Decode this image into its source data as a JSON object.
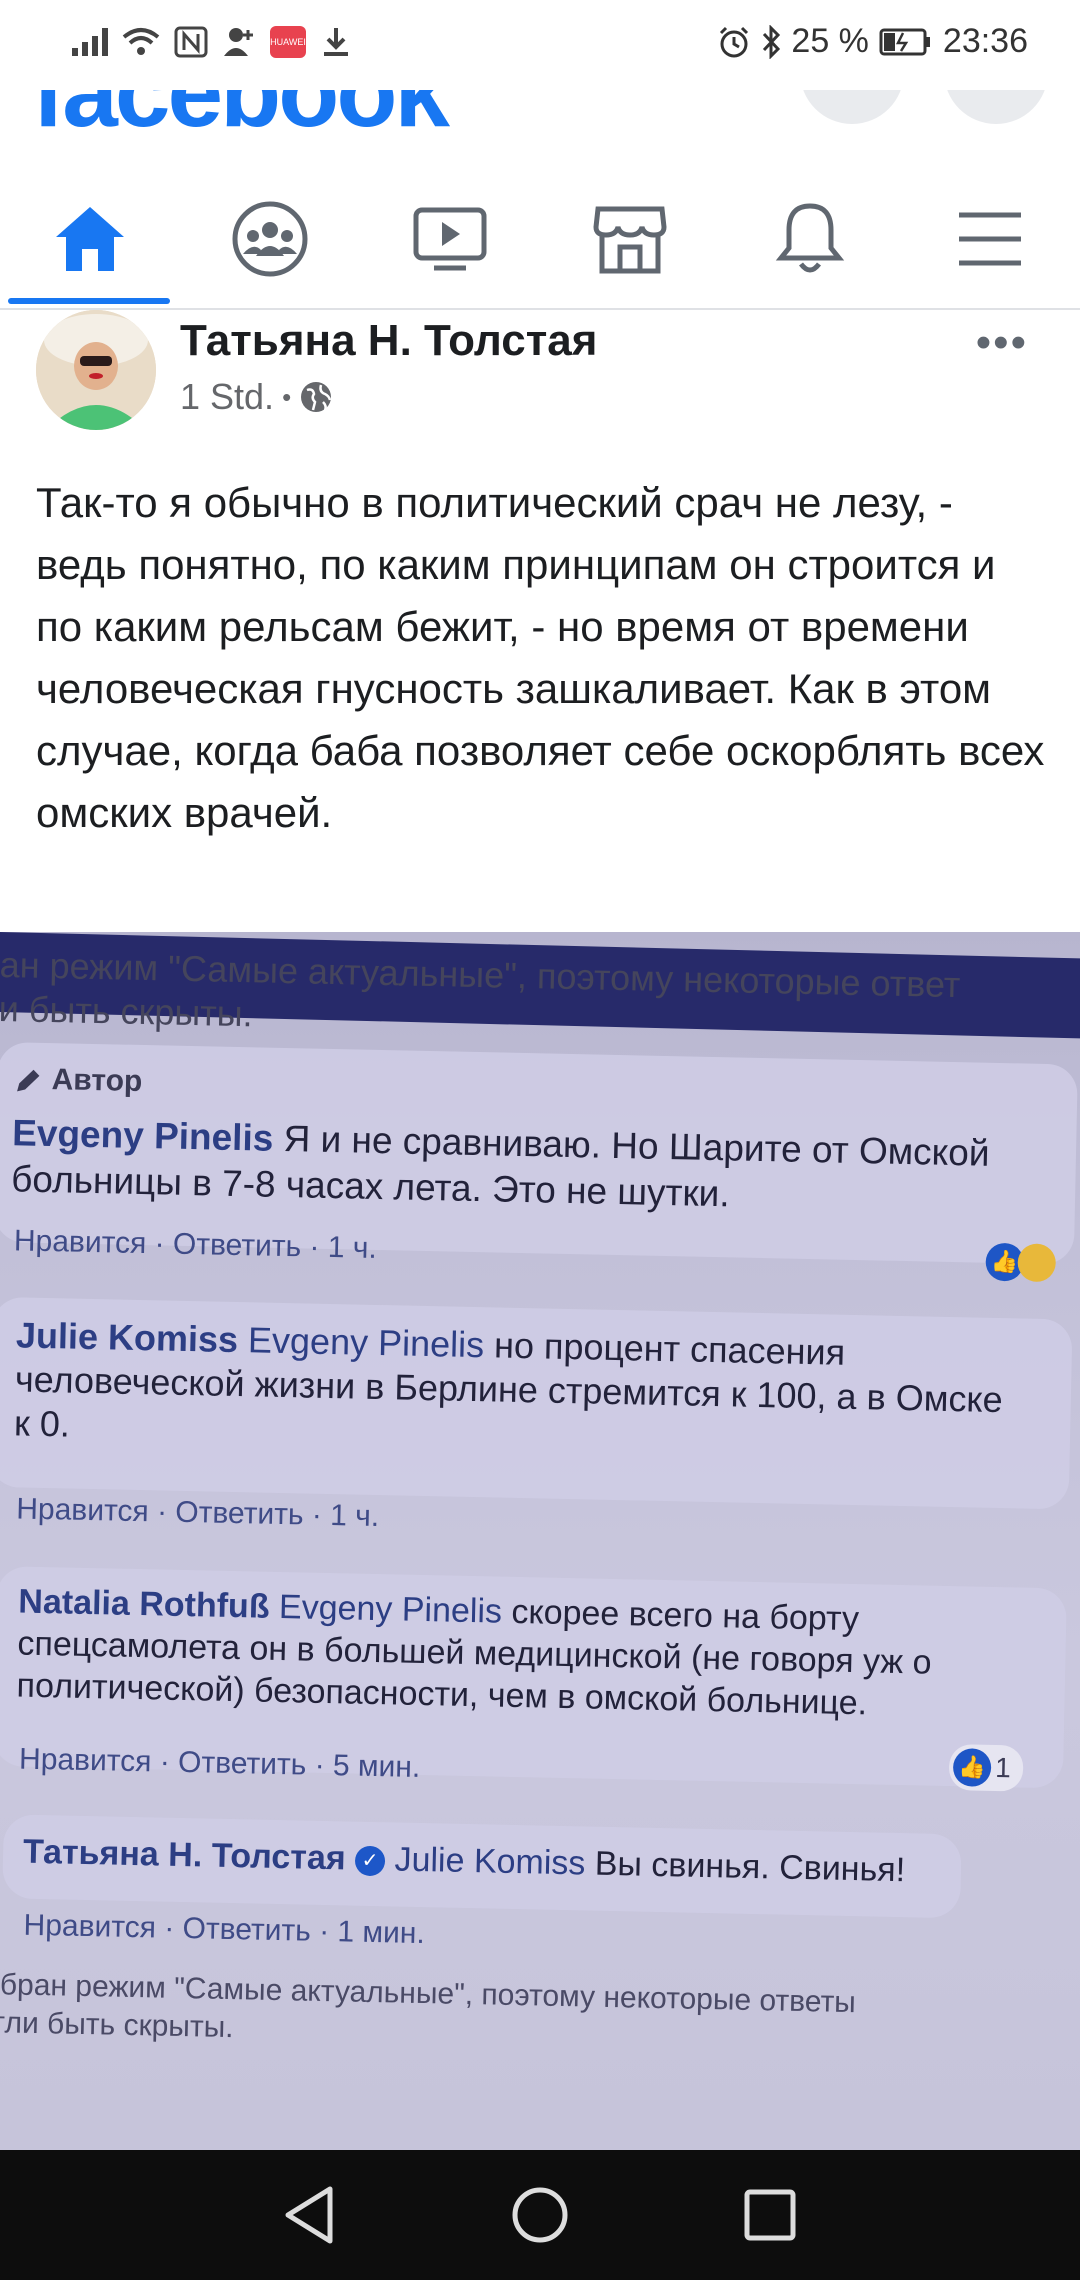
{
  "status_bar": {
    "battery": "25 %",
    "time": "23:36",
    "huawei_badge": "HUAWEI"
  },
  "header": {
    "logo": "facebook",
    "colors": {
      "brand": "#1877f2"
    }
  },
  "nav": {
    "tabs": [
      {
        "name": "home",
        "icon": "home-icon",
        "active": true
      },
      {
        "name": "groups",
        "icon": "groups-icon"
      },
      {
        "name": "watch",
        "icon": "video-icon"
      },
      {
        "name": "marketplace",
        "icon": "store-icon"
      },
      {
        "name": "notifications",
        "icon": "bell-icon"
      },
      {
        "name": "menu",
        "icon": "hamburger-icon"
      }
    ]
  },
  "post": {
    "author": "Татьяна Н. Толстая",
    "time": "1 Std.",
    "separator": "•",
    "more": "•••",
    "text": "Так-то я обычно в политический срач не лезу, - ведь понятно, по каким принципам он строится и по каким рельсам бежит, - но время от времени человеческая гнусность зашкаливает. Как в этом случае, когда баба позволяет себе оскорблять всех омских врачей."
  },
  "photo": {
    "top_line1": "ан режим \"Самые актуальные\", поэтому некоторые ответ",
    "top_line2": "и быть скрыты.",
    "author_badge": "Автор",
    "comments": [
      {
        "name": "Evgeny Pinelis",
        "mention": "",
        "text_line1": "Я и не сравниваю. Но Шарите от Омской",
        "text_line2": "больницы в 7-8 часах лета. Это не шутки.",
        "text_line3": "",
        "actions": "Нравится · Ответить · 1 ч.",
        "reaction_count": ""
      },
      {
        "name": "Julie Komiss",
        "mention": "Evgeny Pinelis",
        "text_line1": "но процент спасения",
        "text_line2": "человеческой жизни в Берлине стремится к 100, а в Омске",
        "text_line3": "к 0.",
        "actions": "Нравится · Ответить · 1 ч.",
        "reaction_count": ""
      },
      {
        "name": "Natalia Rothfuß",
        "mention": "Evgeny Pinelis",
        "text_line1": "скорее всего на борту",
        "text_line2": "спецсамолета он в большей медицинской (не говоря уж о",
        "text_line3": "политической) безопасности, чем в омской больнице.",
        "actions": "Нравится · Ответить · 5 мин.",
        "reaction_count": "1"
      },
      {
        "name": "Татьяна Н. Толстая",
        "mention": "Julie Komiss",
        "text_line1": "Вы свинья. Свинья!",
        "text_line2": "",
        "text_line3": "",
        "actions": "Нравится · Ответить · 1 мин.",
        "reaction_count": ""
      }
    ],
    "bottom_line1": "ыбран режим \"Самые актуальные\", поэтому некоторые ответы",
    "bottom_line2": "огли быть скрыты."
  }
}
